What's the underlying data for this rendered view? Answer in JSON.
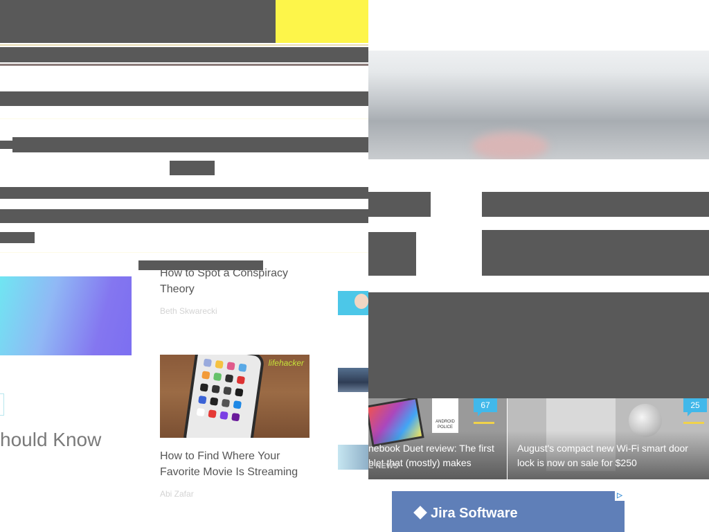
{
  "articles": [
    {
      "title_line1": "How to Spot a Conspiracy",
      "title_line2": "Theory",
      "author": "Beth Skwarecki"
    },
    {
      "title": "How to Find Where Your Favorite Movie Is Streaming",
      "author": "Abi Zafar",
      "thumb_badge": "lifehacker"
    }
  ],
  "left_heading": "hould Know",
  "news_cards": [
    {
      "title": "nebook Duet review: The first blet that (mostly) makes",
      "comments": "67",
      "brand_text": "ANDROID POLICE",
      "source_text": "E NEWS"
    },
    {
      "title": "August's compact new Wi-Fi smart door lock is now on sale for $250",
      "comments": "25"
    }
  ],
  "ad": {
    "text": "Jira Software",
    "badge": "▷"
  },
  "colors": {
    "yellow_accent": "#fdf54a",
    "redacted_block": "#595959",
    "comment_bubble": "#41b8ea",
    "ad_background": "#5f7fb8"
  }
}
